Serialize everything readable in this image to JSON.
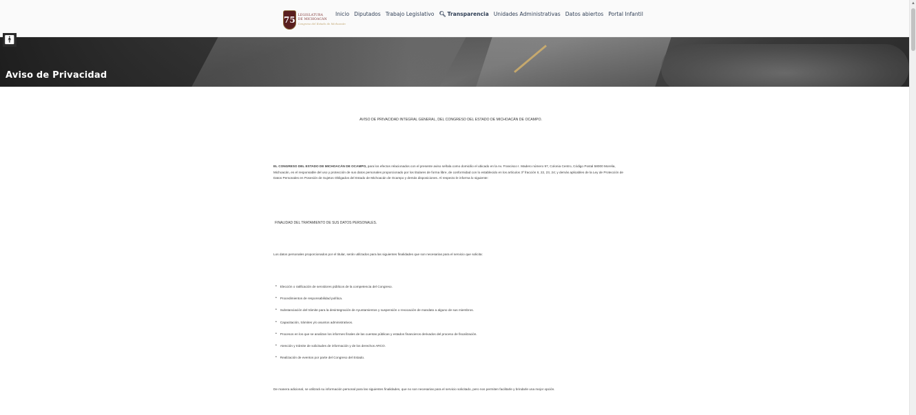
{
  "header": {
    "logo": {
      "number": "75",
      "line1": "LEGISLATURA",
      "line2": "DE MICHOACÁN",
      "line3": "Congreso del Estado de Michoacán"
    },
    "nav": [
      {
        "label": "Inicio"
      },
      {
        "label": "Diputados"
      },
      {
        "label": "Trabajo Legislativo"
      },
      {
        "label": "Transparencia",
        "icon": "search-icon"
      },
      {
        "label": "Unidades Administrativas"
      },
      {
        "label": "Datos abiertos"
      },
      {
        "label": "Portal Infantil"
      }
    ]
  },
  "accessibility": {
    "icon": "accessibility-icon"
  },
  "hero": {
    "title": "Aviso de Privacidad"
  },
  "content": {
    "doc_title": "AVISO DE PRIVACIDAD INTEGRAL GENERAL, DEL CONGRESO DEL ESTADO DE MICHOACÁN DE OCAMPO.",
    "para1_bold": "EL CONGRESO DEL ESTADO DE MICHOACÁN DE OCAMPO,",
    "para1_rest": " para los efectos relacionados con el presente aviso señala como domicilio el ubicado en la Av. Francisco I. Madero número 97, Colonia Centro, Código Postal 58000 Morelia, Michoacán, es el responsable del uso y protección de sus datos personales proporcionado por los titulares de forma libre, de conformidad con lo establecido en los artículos 3º fracción II, 22, 23, 24; y demás aplicables de la Ley de Protección de Datos Personales en Posesión de Sujetos Obligados del Estado de Michoacán de Ocampo y demás disposiciones. Al respecto le informa lo siguiente:",
    "section_title": "FINALIDAD DEL TRATAMIENTO DE SUS DATOS PERSONALES.",
    "para2": "Los datos personales proporcionados por el titular, serán utilizados para las siguientes finalidades que son necesarias para el servicio que solicita:",
    "bullets": [
      "Elección o ratificación de servidores públicos de la competencia del Congreso.",
      "Procedimientos de responsabilidad política.",
      "Substanciación del trámite para la desintegración de Ayuntamientos y suspensión o revocación de mandato a alguno de sus miembros.",
      "Capacitación, trámites y/o asuntos administrativos.",
      "Procesos en los que se analizan los informes finales de las cuentas públicas y estados financieros derivados del proceso de fiscalización.",
      "Atención y trámite de solicitudes de información y de los derechos ARCO.",
      "Realización de eventos por parte del Congreso del Estado."
    ],
    "para3": "De manera adicional, se utilizará su información personal para las siguientes finalidades, que no son necesarias para el servicio solicitado, pero nos permiten facilitarle y brindarle una mejor opción."
  },
  "colors": {
    "nav_text": "#2f3e55",
    "logo_badge": "#5a1f1f",
    "hero_text": "#ffffff"
  }
}
